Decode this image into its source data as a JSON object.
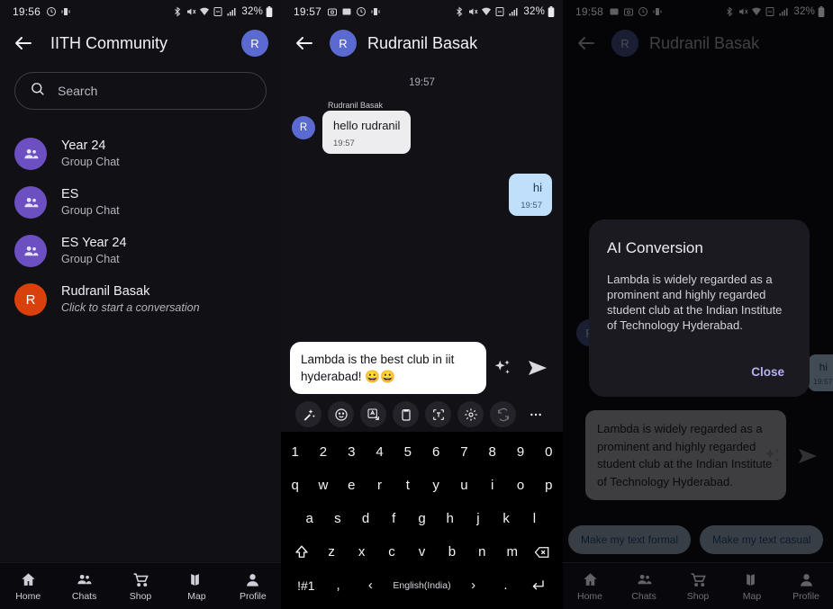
{
  "panel1": {
    "status": {
      "time": "19:56",
      "battery": "32%",
      "left_icons": [
        "clock-icon",
        "vibrate-icon"
      ],
      "right_icons": [
        "bluetooth-icon",
        "mute-icon",
        "wifi-icon",
        "sim-icon",
        "signal-icon"
      ]
    },
    "appbar": {
      "title": "IITH Community",
      "back": "back-arrow",
      "avatar_initial": "R"
    },
    "search": {
      "placeholder": "Search",
      "icon": "search-icon"
    },
    "chats": [
      {
        "avatar": "group",
        "initial": "",
        "name": "Year 24",
        "subtitle": "Group Chat",
        "italic": false
      },
      {
        "avatar": "group",
        "initial": "",
        "name": "ES",
        "subtitle": "Group Chat",
        "italic": false
      },
      {
        "avatar": "group",
        "initial": "",
        "name": "ES Year 24",
        "subtitle": "Group Chat",
        "italic": false
      },
      {
        "avatar": "person",
        "initial": "R",
        "name": "Rudranil Basak",
        "subtitle": "Click to start a conversation",
        "italic": true
      }
    ],
    "nav": [
      {
        "label": "Home",
        "icon": "home-icon"
      },
      {
        "label": "Chats",
        "icon": "chats-icon"
      },
      {
        "label": "Shop",
        "icon": "cart-icon"
      },
      {
        "label": "Map",
        "icon": "map-icon"
      },
      {
        "label": "Profile",
        "icon": "person-icon"
      }
    ]
  },
  "panel2": {
    "status": {
      "time": "19:57",
      "battery": "32%"
    },
    "appbar": {
      "title": "Rudranil Basak",
      "avatar_initial": "R"
    },
    "day_divider": "19:57",
    "incoming": {
      "sender": "Rudranil Basak",
      "avatar_initial": "R",
      "text": "hello rudranil",
      "time": "19:57"
    },
    "outgoing": {
      "text": "hi",
      "time": "19:57"
    },
    "composer": {
      "value": "Lambda is the best club in iit hyderabad! 😀😀",
      "spark_icon": "ai-sparkle-icon",
      "send_icon": "send-icon"
    },
    "toolbar_icons": [
      "magic-wand-icon",
      "emoji-icon",
      "translate-icon",
      "clipboard-icon",
      "text-scan-icon",
      "settings-icon",
      "sync-icon",
      "more-icon"
    ],
    "keyboard": {
      "row1": [
        "1",
        "2",
        "3",
        "4",
        "5",
        "6",
        "7",
        "8",
        "9",
        "0"
      ],
      "row2": [
        "q",
        "w",
        "e",
        "r",
        "t",
        "y",
        "u",
        "i",
        "o",
        "p"
      ],
      "row3": [
        "a",
        "s",
        "d",
        "f",
        "g",
        "h",
        "j",
        "k",
        "l"
      ],
      "row4": [
        "z",
        "x",
        "c",
        "v",
        "b",
        "n",
        "m"
      ],
      "shift_icon": "shift-icon",
      "backspace_icon": "backspace-icon",
      "symbols_key": "!#1",
      "comma_key": ",",
      "prev_key": "‹",
      "language_key": "English(India)",
      "next_key": "›",
      "period_key": ".",
      "enter_icon": "enter-icon"
    }
  },
  "panel3": {
    "status": {
      "time": "19:58",
      "battery": "32%"
    },
    "appbar": {
      "title": "Rudranil Basak",
      "avatar_initial": "R"
    },
    "dialog": {
      "title": "AI Conversion",
      "body": "Lambda is widely regarded as a prominent and highly regarded student club at the Indian Institute of Technology Hyderabad.",
      "close_label": "Close"
    },
    "peek_bubble": {
      "text": "hi",
      "time": "19:57"
    },
    "avatar_initial": "R",
    "ai_message": "Lambda is widely regarded as a prominent and highly regarded student club at the Indian Institute of Technology Hyderabad.",
    "composer": {
      "spark_icon": "ai-sparkle-icon",
      "send_icon": "send-icon"
    },
    "chips": [
      "Make my text formal",
      "Make my text casual"
    ],
    "nav": [
      {
        "label": "Home",
        "icon": "home-icon"
      },
      {
        "label": "Chats",
        "icon": "chats-icon"
      },
      {
        "label": "Shop",
        "icon": "cart-icon"
      },
      {
        "label": "Map",
        "icon": "map-icon"
      },
      {
        "label": "Profile",
        "icon": "person-icon"
      }
    ]
  }
}
